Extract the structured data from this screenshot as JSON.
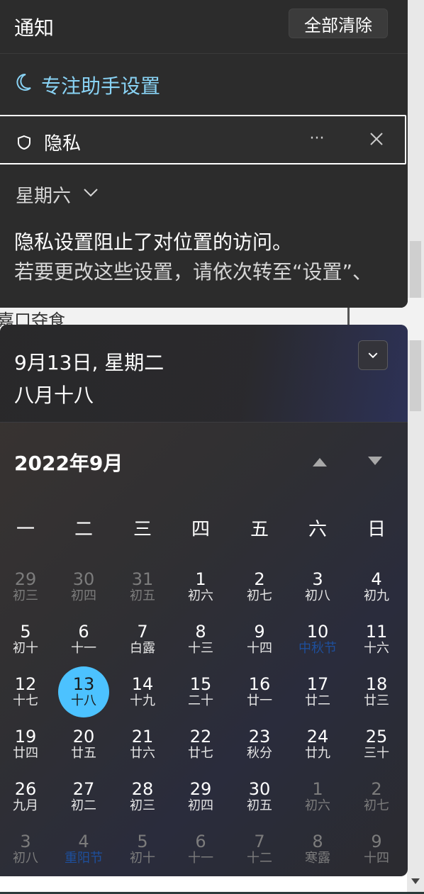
{
  "notifications": {
    "title": "通知",
    "clear_all": "全部清除",
    "focus_assist": "专注助手设置",
    "card": {
      "app": "隐私",
      "more": "···",
      "day": "星期六",
      "line1": "隐私设置阻止了对位置的访问。",
      "line2": "若要更改这些设置，请依次转至“设置”、"
    }
  },
  "background": {
    "partial_text": "嘉口夺食"
  },
  "calendar": {
    "date_line": "9月13日, 星期二",
    "lunar_line": "八月十八",
    "month_title": "2022年9月",
    "weekdays": [
      "一",
      "二",
      "三",
      "四",
      "五",
      "六",
      "日"
    ],
    "weeks": [
      [
        {
          "n": "29",
          "l": "初三",
          "dim": true
        },
        {
          "n": "30",
          "l": "初四",
          "dim": true
        },
        {
          "n": "31",
          "l": "初五",
          "dim": true
        },
        {
          "n": "1",
          "l": "初六"
        },
        {
          "n": "2",
          "l": "初七"
        },
        {
          "n": "3",
          "l": "初八"
        },
        {
          "n": "4",
          "l": "初九"
        }
      ],
      [
        {
          "n": "5",
          "l": "初十"
        },
        {
          "n": "6",
          "l": "十一"
        },
        {
          "n": "7",
          "l": "白露"
        },
        {
          "n": "8",
          "l": "十三"
        },
        {
          "n": "9",
          "l": "十四"
        },
        {
          "n": "10",
          "l": "中秋节",
          "fest": true
        },
        {
          "n": "11",
          "l": "十六"
        }
      ],
      [
        {
          "n": "12",
          "l": "十七"
        },
        {
          "n": "13",
          "l": "十八",
          "today": true
        },
        {
          "n": "14",
          "l": "十九"
        },
        {
          "n": "15",
          "l": "二十"
        },
        {
          "n": "16",
          "l": "廿一"
        },
        {
          "n": "17",
          "l": "廿二"
        },
        {
          "n": "18",
          "l": "廿三"
        }
      ],
      [
        {
          "n": "19",
          "l": "廿四"
        },
        {
          "n": "20",
          "l": "廿五"
        },
        {
          "n": "21",
          "l": "廿六"
        },
        {
          "n": "22",
          "l": "廿七"
        },
        {
          "n": "23",
          "l": "秋分"
        },
        {
          "n": "24",
          "l": "廿九"
        },
        {
          "n": "25",
          "l": "三十"
        }
      ],
      [
        {
          "n": "26",
          "l": "九月"
        },
        {
          "n": "27",
          "l": "初二"
        },
        {
          "n": "28",
          "l": "初三"
        },
        {
          "n": "29",
          "l": "初四"
        },
        {
          "n": "30",
          "l": "初五"
        },
        {
          "n": "1",
          "l": "初六",
          "dim": true
        },
        {
          "n": "2",
          "l": "初七",
          "dim": true
        }
      ],
      [
        {
          "n": "3",
          "l": "初八",
          "dim": true
        },
        {
          "n": "4",
          "l": "重阳节",
          "dim": true,
          "fest": true
        },
        {
          "n": "5",
          "l": "初十",
          "dim": true
        },
        {
          "n": "6",
          "l": "十一",
          "dim": true
        },
        {
          "n": "7",
          "l": "十二",
          "dim": true
        },
        {
          "n": "8",
          "l": "寒露",
          "dim": true
        },
        {
          "n": "9",
          "l": "十四",
          "dim": true
        }
      ]
    ]
  },
  "colors": {
    "accent": "#4cc2ff",
    "link": "#89d3f5",
    "festival": "#1e4f9c"
  }
}
